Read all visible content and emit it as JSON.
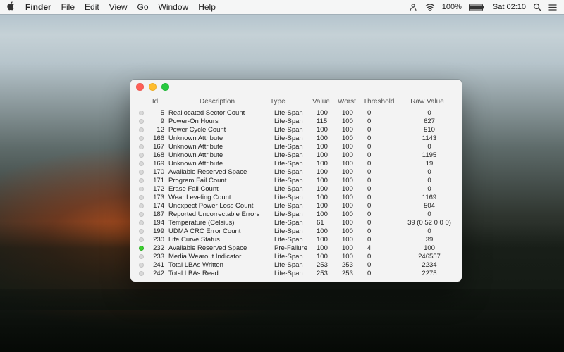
{
  "menubar": {
    "apple": "",
    "app": "Finder",
    "items": [
      "File",
      "Edit",
      "View",
      "Go",
      "Window",
      "Help"
    ],
    "right": {
      "wifi": "",
      "battery_pct": "100%",
      "battery_icon": "battery-full",
      "clock": "Sat 02:10",
      "search": "",
      "list": ""
    }
  },
  "columns": {
    "dot": "",
    "id": "Id",
    "desc": "Description",
    "type": "Type",
    "value": "Value",
    "worst": "Worst",
    "threshold": "Threshold",
    "raw": "Raw Value"
  },
  "rows": [
    {
      "status": "ok",
      "id": "5",
      "desc": "Reallocated Sector Count",
      "type": "Life-Span",
      "value": "100",
      "worst": "100",
      "threshold": "0",
      "raw": "0"
    },
    {
      "status": "ok",
      "id": "9",
      "desc": "Power-On Hours",
      "type": "Life-Span",
      "value": "115",
      "worst": "100",
      "threshold": "0",
      "raw": "627"
    },
    {
      "status": "ok",
      "id": "12",
      "desc": "Power Cycle Count",
      "type": "Life-Span",
      "value": "100",
      "worst": "100",
      "threshold": "0",
      "raw": "510"
    },
    {
      "status": "ok",
      "id": "166",
      "desc": "Unknown Attribute",
      "type": "Life-Span",
      "value": "100",
      "worst": "100",
      "threshold": "0",
      "raw": "1143"
    },
    {
      "status": "ok",
      "id": "167",
      "desc": "Unknown Attribute",
      "type": "Life-Span",
      "value": "100",
      "worst": "100",
      "threshold": "0",
      "raw": "0"
    },
    {
      "status": "ok",
      "id": "168",
      "desc": "Unknown Attribute",
      "type": "Life-Span",
      "value": "100",
      "worst": "100",
      "threshold": "0",
      "raw": "1195"
    },
    {
      "status": "ok",
      "id": "169",
      "desc": "Unknown Attribute",
      "type": "Life-Span",
      "value": "100",
      "worst": "100",
      "threshold": "0",
      "raw": "19"
    },
    {
      "status": "ok",
      "id": "170",
      "desc": "Available Reserved Space",
      "type": "Life-Span",
      "value": "100",
      "worst": "100",
      "threshold": "0",
      "raw": "0"
    },
    {
      "status": "ok",
      "id": "171",
      "desc": "Program Fail Count",
      "type": "Life-Span",
      "value": "100",
      "worst": "100",
      "threshold": "0",
      "raw": "0"
    },
    {
      "status": "ok",
      "id": "172",
      "desc": "Erase Fail Count",
      "type": "Life-Span",
      "value": "100",
      "worst": "100",
      "threshold": "0",
      "raw": "0"
    },
    {
      "status": "ok",
      "id": "173",
      "desc": "Wear Leveling Count",
      "type": "Life-Span",
      "value": "100",
      "worst": "100",
      "threshold": "0",
      "raw": "1169"
    },
    {
      "status": "ok",
      "id": "174",
      "desc": "Unexpect Power Loss Count",
      "type": "Life-Span",
      "value": "100",
      "worst": "100",
      "threshold": "0",
      "raw": "504"
    },
    {
      "status": "ok",
      "id": "187",
      "desc": "Reported Uncorrectable Errors",
      "type": "Life-Span",
      "value": "100",
      "worst": "100",
      "threshold": "0",
      "raw": "0"
    },
    {
      "status": "ok",
      "id": "194",
      "desc": "Temperature (Celsius)",
      "type": "Life-Span",
      "value": "61",
      "worst": "100",
      "threshold": "0",
      "raw": "39 (0 52 0 0 0)"
    },
    {
      "status": "ok",
      "id": "199",
      "desc": "UDMA CRC Error Count",
      "type": "Life-Span",
      "value": "100",
      "worst": "100",
      "threshold": "0",
      "raw": "0"
    },
    {
      "status": "ok",
      "id": "230",
      "desc": "Life Curve Status",
      "type": "Life-Span",
      "value": "100",
      "worst": "100",
      "threshold": "0",
      "raw": "39"
    },
    {
      "status": "green",
      "id": "232",
      "desc": "Available Reserved Space",
      "type": "Pre-Failure",
      "value": "100",
      "worst": "100",
      "threshold": "4",
      "raw": "100"
    },
    {
      "status": "ok",
      "id": "233",
      "desc": "Media Wearout Indicator",
      "type": "Life-Span",
      "value": "100",
      "worst": "100",
      "threshold": "0",
      "raw": "246557"
    },
    {
      "status": "ok",
      "id": "241",
      "desc": "Total LBAs Written",
      "type": "Life-Span",
      "value": "253",
      "worst": "253",
      "threshold": "0",
      "raw": "2234"
    },
    {
      "status": "ok",
      "id": "242",
      "desc": "Total LBAs Read",
      "type": "Life-Span",
      "value": "253",
      "worst": "253",
      "threshold": "0",
      "raw": "2275"
    }
  ]
}
